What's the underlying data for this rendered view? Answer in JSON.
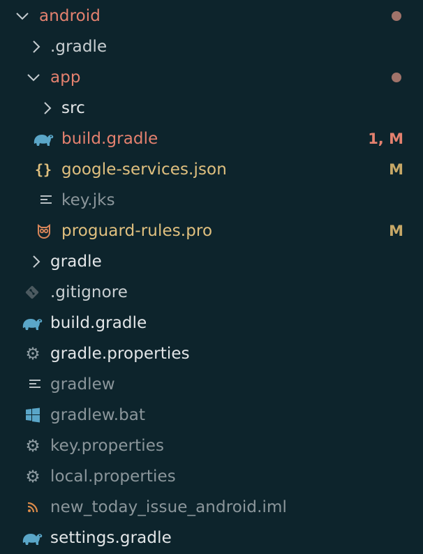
{
  "explorer": {
    "colors": {
      "background": "#0d242c",
      "text": "#e3e6e8",
      "modified_red": "#e4816f",
      "modified_yellow": "#e0c07f",
      "muted": "#8b969b",
      "dot": "#a0736a",
      "gradle_blue": "#5aa6c8",
      "gear": "#8d9ba1"
    },
    "items": [
      {
        "label": "android",
        "type": "folder",
        "expanded": true,
        "depth": 0,
        "status": "dot",
        "icon": "chevron-down-icon"
      },
      {
        "label": ".gradle",
        "type": "folder",
        "expanded": false,
        "depth": 1,
        "status": "",
        "icon": "chevron-right-icon"
      },
      {
        "label": "app",
        "type": "folder",
        "expanded": true,
        "depth": 1,
        "status": "dot",
        "icon": "chevron-down-icon"
      },
      {
        "label": "src",
        "type": "folder",
        "expanded": false,
        "depth": 2,
        "status": "",
        "icon": "chevron-right-icon"
      },
      {
        "label": "build.gradle",
        "type": "file",
        "depth": 2,
        "status": "1, M",
        "icon": "gradle-elephant-icon"
      },
      {
        "label": "google-services.json",
        "type": "file",
        "depth": 2,
        "status": "M",
        "icon": "json-braces-icon"
      },
      {
        "label": "key.jks",
        "type": "file",
        "depth": 2,
        "status": "",
        "icon": "text-lines-icon"
      },
      {
        "label": "proguard-rules.pro",
        "type": "file",
        "depth": 2,
        "status": "M",
        "icon": "owl-icon"
      },
      {
        "label": "gradle",
        "type": "folder",
        "expanded": false,
        "depth": 1,
        "status": "",
        "icon": "chevron-right-icon"
      },
      {
        "label": ".gitignore",
        "type": "file",
        "depth": 1,
        "status": "",
        "icon": "git-icon"
      },
      {
        "label": "build.gradle",
        "type": "file",
        "depth": 1,
        "status": "",
        "icon": "gradle-elephant-icon"
      },
      {
        "label": "gradle.properties",
        "type": "file",
        "depth": 1,
        "status": "",
        "icon": "gear-icon"
      },
      {
        "label": "gradlew",
        "type": "file",
        "depth": 1,
        "status": "",
        "icon": "text-lines-icon"
      },
      {
        "label": "gradlew.bat",
        "type": "file",
        "depth": 1,
        "status": "",
        "icon": "windows-icon"
      },
      {
        "label": "key.properties",
        "type": "file",
        "depth": 1,
        "status": "",
        "icon": "gear-icon"
      },
      {
        "label": "local.properties",
        "type": "file",
        "depth": 1,
        "status": "",
        "icon": "gear-icon"
      },
      {
        "label": "new_today_issue_android.iml",
        "type": "file",
        "depth": 1,
        "status": "",
        "icon": "rss-icon"
      },
      {
        "label": "settings.gradle",
        "type": "file",
        "depth": 1,
        "status": "",
        "icon": "gradle-elephant-icon"
      }
    ]
  }
}
